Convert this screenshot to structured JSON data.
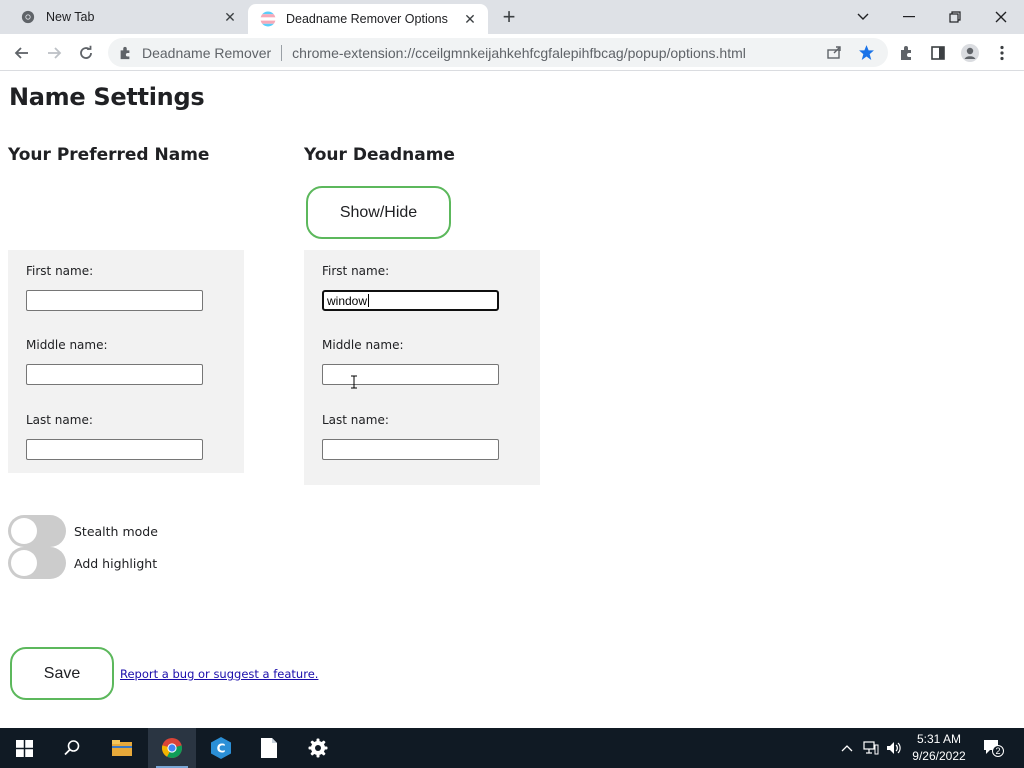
{
  "browser": {
    "tabs": [
      {
        "title": "New Tab",
        "active": false
      },
      {
        "title": "Deadname Remover Options",
        "active": true
      }
    ],
    "omnibox": {
      "site_name": "Deadname Remover",
      "url": "chrome-extension://cceilgmnkeijahkehfcgfalepihfbcag/popup/options.html"
    }
  },
  "page": {
    "title": "Name Settings",
    "preferred": {
      "heading": "Your Preferred Name",
      "first_label": "First name:",
      "first_value": "",
      "middle_label": "Middle name:",
      "middle_value": "",
      "last_label": "Last name:",
      "last_value": ""
    },
    "deadname": {
      "heading": "Your Deadname",
      "show_hide_label": "Show/Hide",
      "first_label": "First name:",
      "first_value": "window",
      "middle_label": "Middle name:",
      "middle_value": "",
      "last_label": "Last name:",
      "last_value": ""
    },
    "toggles": [
      {
        "label": "Stealth mode",
        "on": false
      },
      {
        "label": "Add highlight",
        "on": false
      }
    ],
    "save_label": "Save",
    "report_link": "Report a bug or suggest a feature."
  },
  "taskbar": {
    "time": "5:31 AM",
    "date": "9/26/2022",
    "notification_count": "2"
  },
  "colors": {
    "accent_border": "#5cb85c",
    "taskbar_bg": "#101a24",
    "tabstrip_bg": "#dee1e6",
    "link": "#1a0dab"
  }
}
